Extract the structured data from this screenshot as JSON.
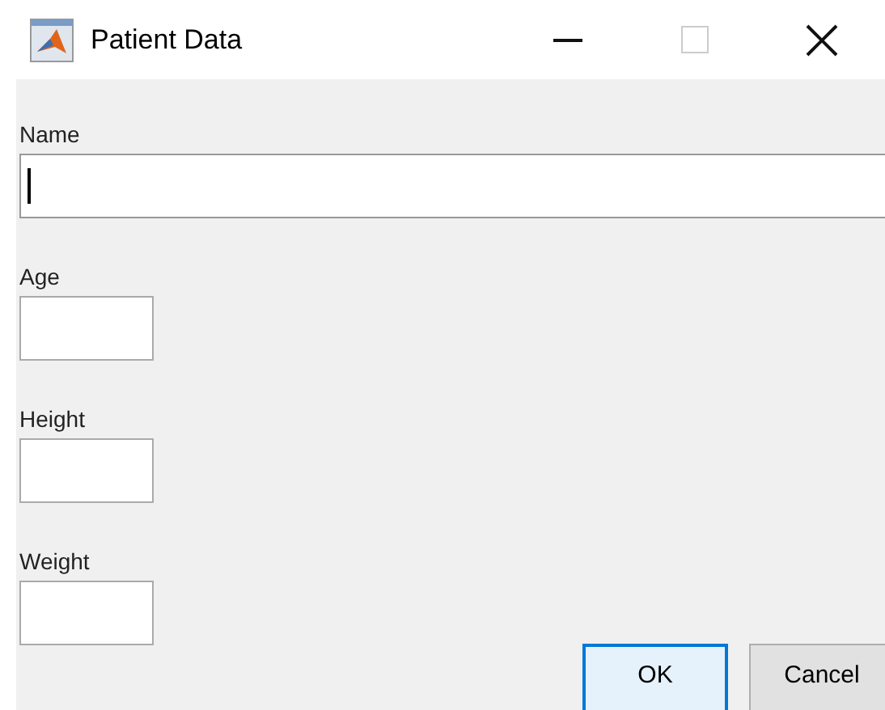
{
  "window": {
    "title": "Patient Data"
  },
  "fields": [
    {
      "label": "Name",
      "focused": true
    },
    {
      "label": "Age",
      "focused": false
    },
    {
      "label": "Height",
      "focused": false
    },
    {
      "label": "Weight",
      "focused": false
    }
  ],
  "buttons": [
    {
      "label": "OK",
      "default": true
    },
    {
      "label": "Cancel",
      "default": false
    }
  ]
}
